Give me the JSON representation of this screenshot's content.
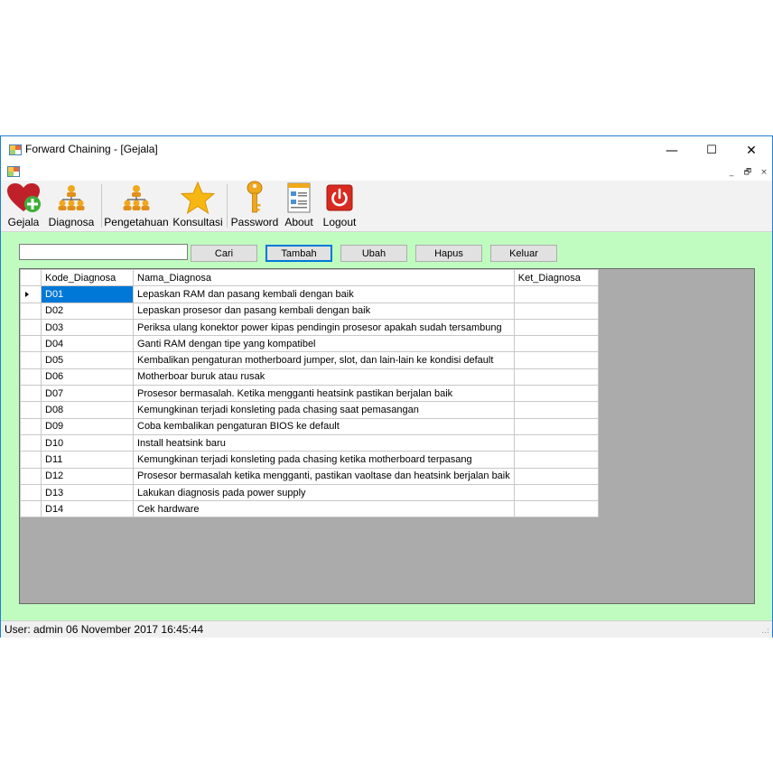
{
  "window": {
    "title": "Forward Chaining - [Gejala]",
    "caption": {
      "minimize": "—",
      "maximize": "☐",
      "close": "✕"
    },
    "mdi": {
      "minimize": "_",
      "restore": "🗗",
      "close": "×"
    }
  },
  "toolbar": {
    "items": [
      {
        "label": "Gejala",
        "icon": "heart-plus-icon"
      },
      {
        "label": "Diagnosa",
        "icon": "hierarchy-icon"
      },
      {
        "label": "Pengetahuan",
        "icon": "hierarchy-icon"
      },
      {
        "label": "Konsultasi",
        "icon": "star-icon"
      },
      {
        "label": "Password",
        "icon": "key-icon"
      },
      {
        "label": "About",
        "icon": "document-icon"
      },
      {
        "label": "Logout",
        "icon": "power-icon"
      }
    ]
  },
  "search": {
    "value": "",
    "placeholder": ""
  },
  "buttons": {
    "cari": "Cari",
    "tambah": "Tambah",
    "ubah": "Ubah",
    "hapus": "Hapus",
    "keluar": "Keluar"
  },
  "grid": {
    "columns": [
      "Kode_Diagnosa",
      "Nama_Diagnosa",
      "Ket_Diagnosa"
    ],
    "rows": [
      [
        "D01",
        "Lepaskan RAM dan pasang kembali dengan baik",
        ""
      ],
      [
        "D02",
        "Lepaskan prosesor dan pasang kembali dengan baik",
        ""
      ],
      [
        "D03",
        "Periksa ulang konektor power kipas pendingin prosesor apakah sudah tersambung",
        ""
      ],
      [
        "D04",
        "Ganti RAM dengan tipe yang kompatibel",
        ""
      ],
      [
        "D05",
        "Kembalikan pengaturan motherboard jumper, slot, dan lain-lain ke kondisi default",
        ""
      ],
      [
        "D06",
        "Motherboar buruk atau rusak",
        ""
      ],
      [
        "D07",
        "Prosesor bermasalah. Ketika mengganti heatsink pastikan berjalan baik",
        ""
      ],
      [
        "D08",
        "Kemungkinan terjadi konsleting pada chasing saat pemasangan",
        ""
      ],
      [
        "D09",
        "Coba kembalikan pengaturan BIOS ke default",
        ""
      ],
      [
        "D10",
        "Install heatsink baru",
        ""
      ],
      [
        "D11",
        "Kemungkinan terjadi konsleting pada chasing ketika motherboard terpasang",
        ""
      ],
      [
        "D12",
        "Prosesor bermasalah ketika mengganti, pastikan vaoltase dan heatsink berjalan baik",
        ""
      ],
      [
        "D13",
        "Lakukan diagnosis pada power supply",
        ""
      ],
      [
        "D14",
        "Cek hardware",
        ""
      ]
    ]
  },
  "status": {
    "text": "User: admin  06 November 2017 16:45:44",
    "grip": "..:"
  },
  "colors": {
    "content_bg": "#c0fcc0",
    "selection": "#0078d7",
    "grid_bg": "#ababab"
  }
}
